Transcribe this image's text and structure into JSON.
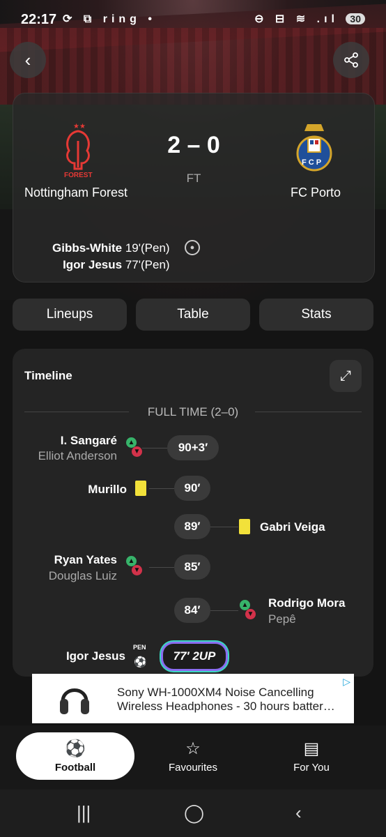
{
  "status": {
    "time": "22:17",
    "notif_icons": "⟳ ⧉ ring •",
    "right_icons": "⊖ ⊟ ≋ .ıl",
    "battery": "30"
  },
  "match": {
    "home_team": "Nottingham Forest",
    "away_team": "FC Porto",
    "score": "2 – 0",
    "status": "FT",
    "home_crest_text": "FOREST",
    "away_crest_text": "F C P",
    "scorers": [
      {
        "name": "Gibbs-White",
        "detail": "19'(Pen)"
      },
      {
        "name": "Igor Jesus",
        "detail": "77'(Pen)"
      }
    ]
  },
  "tabs": [
    "Lineups",
    "Table",
    "Stats"
  ],
  "timeline": {
    "title": "Timeline",
    "fulltime_label": "FULL TIME (2–0)",
    "events": {
      "e1": {
        "minute": "90+3′",
        "in": "I. Sangaré",
        "out": "Elliot Anderson"
      },
      "e2": {
        "minute": "90′",
        "player": "Murillo"
      },
      "e3": {
        "minute": "89′",
        "player": "Gabri Veiga"
      },
      "e4": {
        "minute": "85′",
        "in": "Ryan Yates",
        "out": "Douglas Luiz"
      },
      "e5": {
        "minute": "84′",
        "in": "Rodrigo Mora",
        "out": "Pepê"
      },
      "e6": {
        "minute": "77′ 2UP",
        "player": "Igor Jesus",
        "tag": "PEN"
      }
    }
  },
  "ad": {
    "line1": "Sony WH-1000XM4 Noise Cancelling",
    "line2": "Wireless Headphones - 30 hours batter…"
  },
  "nav": [
    {
      "label": "Football",
      "icon": "football-icon"
    },
    {
      "label": "Favourites",
      "icon": "star-icon"
    },
    {
      "label": "For You",
      "icon": "for-you-icon"
    }
  ]
}
